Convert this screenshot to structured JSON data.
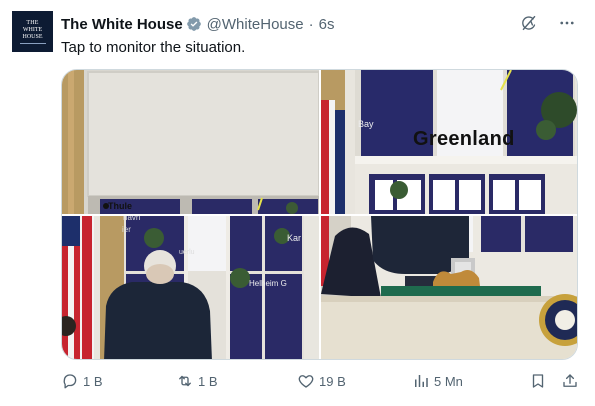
{
  "account": {
    "avatar_line1": "THE",
    "avatar_line2": "WHITE",
    "avatar_line3": "HOUSE",
    "name": "The White House",
    "handle": "@WhiteHouse",
    "separator": "·",
    "time": "6s",
    "verified": true,
    "verified_color": "#829aab"
  },
  "top_icons": [
    "grok-icon",
    "more-icon"
  ],
  "tweet": {
    "text": "Tap to monitor the situation."
  },
  "media": {
    "labels": {
      "thule": "Thule",
      "bay": "Bay",
      "greenland": "Greenland",
      "shavn": "havn",
      "ier": "ier",
      "kar": "Kar",
      "uerlu": "uerlu",
      "heim": "Helheim G"
    }
  },
  "actions": {
    "replies": "1 B",
    "reposts": "1 B",
    "likes": "19 B",
    "views": "5 Mn"
  },
  "colors": {
    "text_primary": "#0f1419",
    "text_secondary": "#536471",
    "border": "#cfd9de"
  }
}
